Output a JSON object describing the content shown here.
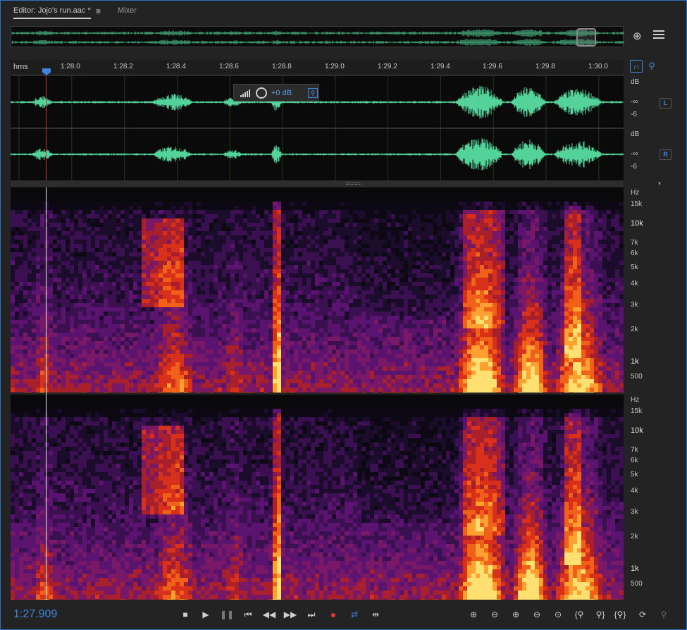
{
  "tabs": {
    "editor_label": "Editor: Jojo's run.aac *",
    "menu_icon": "hamburger-menu-icon",
    "mixer_label": "Mixer"
  },
  "ruler": {
    "unit": "hms",
    "ticks": [
      "1:28.0",
      "1:28.2",
      "1:28.4",
      "1:28.6",
      "1:28.8",
      "1:29.0",
      "1:29.2",
      "1:29.4",
      "1:29.6",
      "1:29.8",
      "1:30.0"
    ]
  },
  "hud": {
    "volume": "+0 dB"
  },
  "channels": [
    {
      "badge": "L",
      "scale": [
        "dB",
        "-∞",
        "-6"
      ]
    },
    {
      "badge": "R",
      "scale": [
        "dB",
        "-∞",
        "-6"
      ]
    }
  ],
  "spectral": {
    "unit": "Hz",
    "labels": [
      "15k",
      "10k",
      "7k",
      "6k",
      "5k",
      "4k",
      "3k",
      "2k",
      "1k",
      "500"
    ],
    "major": [
      "10k",
      "1k"
    ]
  },
  "transport": {
    "timecode": "1:27.909",
    "buttons": [
      "stop-icon",
      "play-icon",
      "pause-icon",
      "go-to-start-icon",
      "rewind-icon",
      "fast-forward-icon",
      "go-to-end-icon",
      "record-icon",
      "loop-icon",
      "skip-selection-icon"
    ]
  },
  "zoom_tools": [
    "zoom-in-amplitude-icon",
    "zoom-out-amplitude-icon",
    "zoom-in-time-icon",
    "zoom-out-time-icon",
    "zoom-out-full-icon",
    "zoom-in-selection-start-icon",
    "zoom-in-selection-end-icon",
    "zoom-selection-icon",
    "zoom-to-playhead-icon",
    "zoom-reset-icon"
  ],
  "colors": {
    "accent": "#3d86d8",
    "waveform": "#53d39a",
    "record": "#e03a3a"
  }
}
